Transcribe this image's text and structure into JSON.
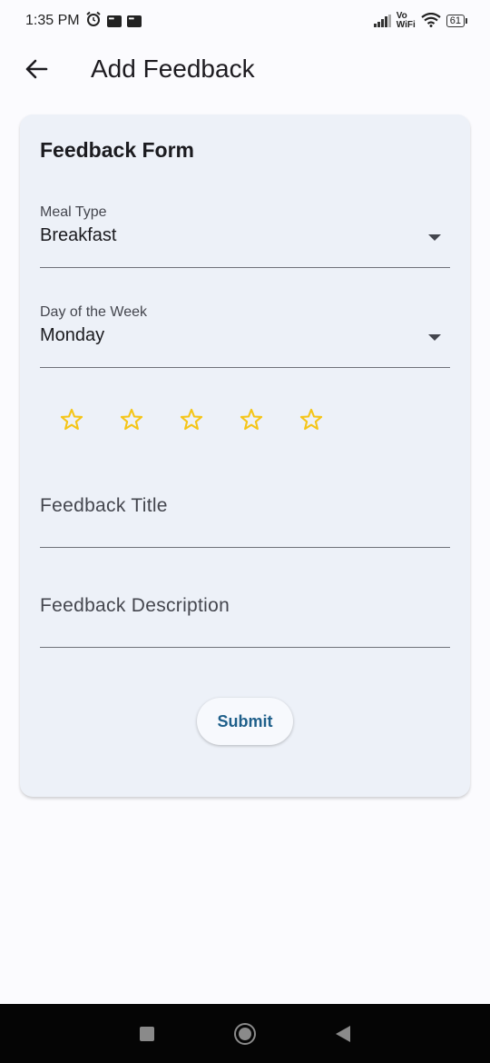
{
  "status_bar": {
    "time": "1:35 PM",
    "network_label_top": "Vo",
    "network_label_bottom": "WiFi",
    "battery": "61",
    "icons": [
      "alarm-icon",
      "message-icon",
      "message-icon",
      "signal-icon",
      "wifi-icon",
      "battery-icon"
    ]
  },
  "app_bar": {
    "title": "Add Feedback",
    "back_icon": "arrow-left-icon"
  },
  "form": {
    "title": "Feedback Form",
    "meal_type": {
      "label": "Meal Type",
      "value": "Breakfast"
    },
    "day_of_week": {
      "label": "Day of the Week",
      "value": "Monday"
    },
    "rating": {
      "value": 0,
      "max": 5,
      "star_color": "#f5c518"
    },
    "feedback_title": {
      "placeholder": "Feedback Title",
      "value": ""
    },
    "feedback_description": {
      "placeholder": "Feedback Description",
      "value": ""
    },
    "submit_label": "Submit"
  },
  "colors": {
    "background": "#fbfbfe",
    "card": "#edf1f8",
    "accent": "#1e5f8a"
  },
  "nav_bar": {
    "icons": [
      "recent-apps-icon",
      "home-icon",
      "back-icon"
    ]
  }
}
